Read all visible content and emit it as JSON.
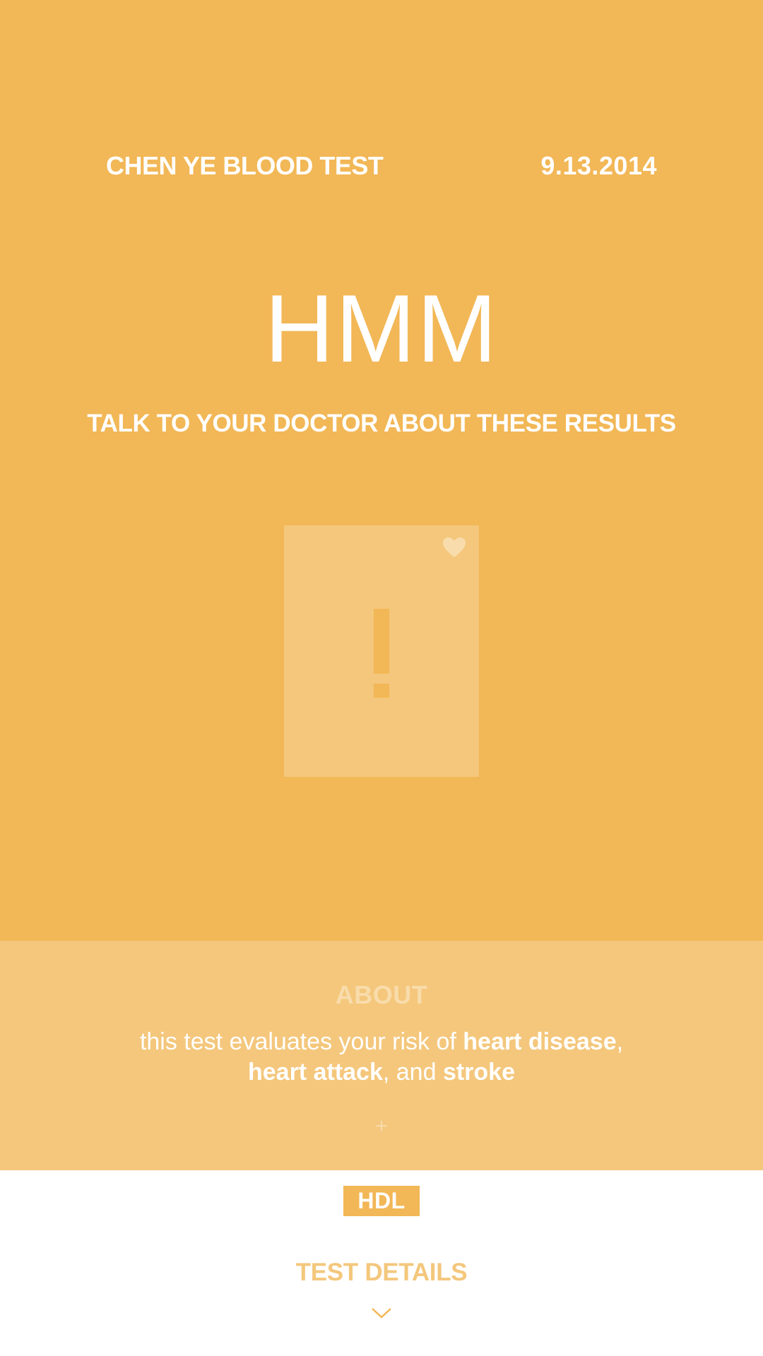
{
  "header": {
    "title": "CHEN YE BLOOD TEST",
    "date": "9.13.2014"
  },
  "result": {
    "verdict": "HMM",
    "advice": "TALK TO YOUR DOCTOR ABOUT THESE RESULTS",
    "card_icons": [
      "heart-icon",
      "exclamation-icon"
    ]
  },
  "about": {
    "heading": "ABOUT",
    "text_prefix": "this test evaluates your risk of ",
    "term_1": "heart disease",
    "sep_1": ",",
    "term_2": "heart attack",
    "sep_2": ", and ",
    "term_3": "stroke",
    "expand_symbol": "+"
  },
  "test": {
    "tag": "HDL",
    "details_label": "TEST DETAILS"
  },
  "colors": {
    "primary": "#F2B756",
    "light": "#F4C77C",
    "pale": "#F9DCAB",
    "background": "#FFFFFF"
  }
}
